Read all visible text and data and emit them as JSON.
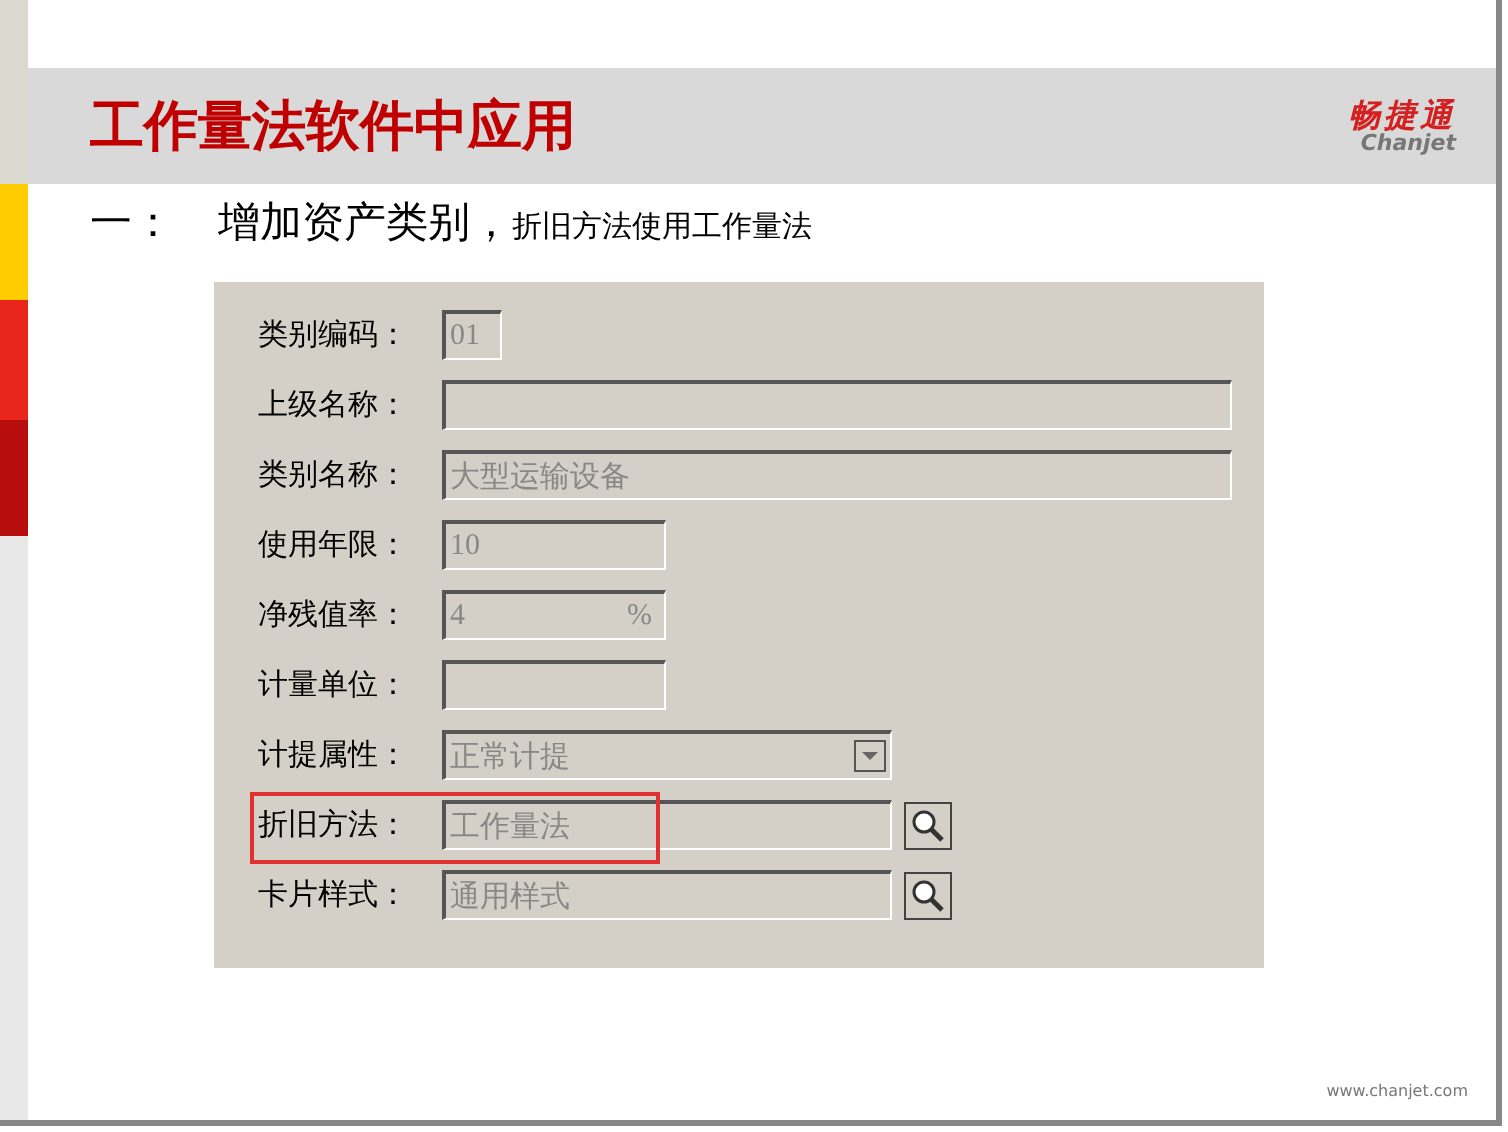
{
  "header": {
    "title": "工作量法软件中应用",
    "logo": {
      "name": "畅捷通",
      "latin": "Chanjet"
    }
  },
  "subtitle": {
    "lead": "一：",
    "main": "增加资产类别，",
    "note": "折旧方法使用工作量法"
  },
  "form": {
    "fields": [
      {
        "label": "类别编码：",
        "kind": "code",
        "value": "01",
        "disabled": true,
        "highlighted": false
      },
      {
        "label": "上级名称：",
        "kind": "long",
        "disabled": true,
        "highlighted": false
      },
      {
        "label": "类别名称：",
        "kind": "long",
        "value": "大型运输设备",
        "disabled": true,
        "highlighted": false
      },
      {
        "label": "使用年限：",
        "kind": "short",
        "value": "10",
        "disabled": true,
        "highlighted": false
      },
      {
        "label": "净残值率：",
        "kind": "short",
        "value": "4",
        "suffix": "%",
        "disabled": true,
        "highlighted": false
      },
      {
        "label": "计量单位：",
        "kind": "short",
        "disabled": true,
        "highlighted": false
      },
      {
        "label": "计提属性：",
        "kind": "select",
        "value": "正常计提",
        "disabled": true,
        "highlighted": false
      },
      {
        "label": "折旧方法：",
        "kind": "lookup",
        "value": "工作量法",
        "disabled": true,
        "highlighted": true
      },
      {
        "label": "卡片样式：",
        "kind": "lookup",
        "value": "通用样式",
        "disabled": true,
        "highlighted": false
      }
    ]
  },
  "footer": {
    "url": "www.chanjet.com"
  }
}
